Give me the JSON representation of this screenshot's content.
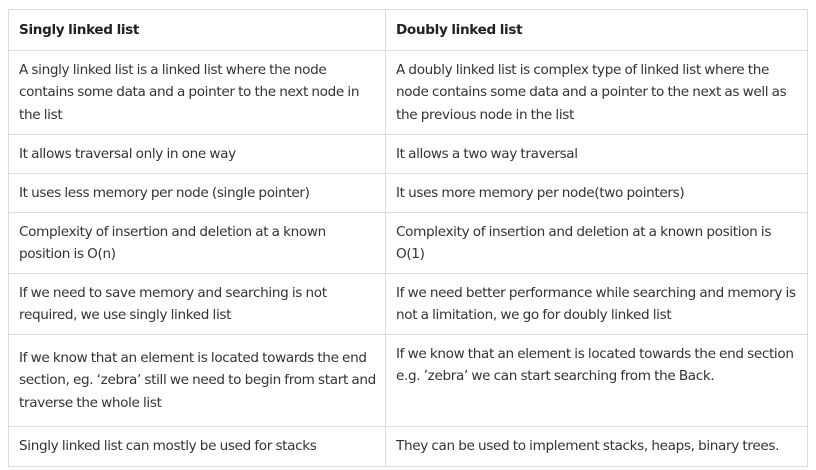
{
  "table": {
    "headers": [
      "Singly linked list",
      "Doubly linked list"
    ],
    "rows": [
      [
        "A singly linked list is a linked list where the node contains some data and a pointer to the next node in the list",
        "A doubly linked list is complex type of linked list where the node contains some data and a pointer to the next as well as the previous node in the list"
      ],
      [
        "It allows traversal only in one way",
        "It allows a two way traversal"
      ],
      [
        "It uses less memory per node (single pointer)",
        "It uses more memory per node(two pointers)"
      ],
      [
        "Complexity of insertion and deletion at a known position is O(n)",
        "Complexity of insertion and deletion at a known position is O(1)"
      ],
      [
        "If we need to save memory and searching is not required, we use singly linked list",
        "If we need better performance while searching and memory is not a limitation, we go for doubly linked list"
      ],
      [
        "If we know that an element is located towards the end section, eg. ‘zebra’ still we need to begin from start and traverse the whole list",
        "If we know that an element is located towards the end section e.g. ’zebra’ we can start searching from the Back."
      ],
      [
        "Singly linked list can mostly be used for stacks",
        "They can be used to implement stacks, heaps, binary trees."
      ]
    ]
  }
}
